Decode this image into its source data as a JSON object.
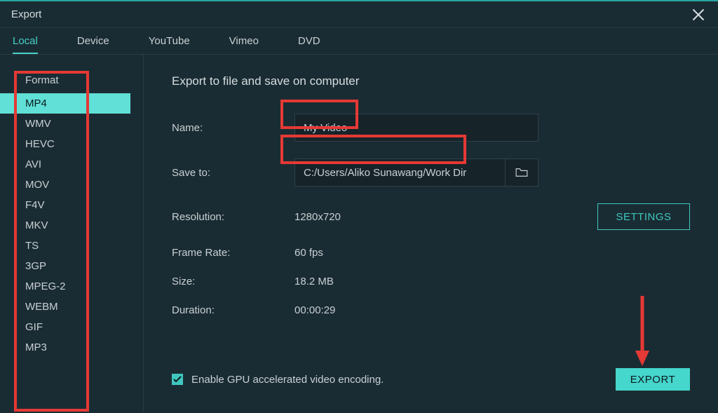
{
  "title": "Export",
  "tabs": [
    "Local",
    "Device",
    "YouTube",
    "Vimeo",
    "DVD"
  ],
  "active_tab": 0,
  "sidebar": {
    "heading": "Format",
    "items": [
      "MP4",
      "WMV",
      "HEVC",
      "AVI",
      "MOV",
      "F4V",
      "MKV",
      "TS",
      "3GP",
      "MPEG-2",
      "WEBM",
      "GIF",
      "MP3"
    ],
    "selected": 0
  },
  "main": {
    "heading": "Export to file and save on computer",
    "name_label": "Name:",
    "name_value": "My Video",
    "save_label": "Save to:",
    "save_value": "C:/Users/Aliko Sunawang/Work Dir",
    "resolution_label": "Resolution:",
    "resolution_value": "1280x720",
    "settings_label": "SETTINGS",
    "framerate_label": "Frame Rate:",
    "framerate_value": "60 fps",
    "size_label": "Size:",
    "size_value": "18.2 MB",
    "duration_label": "Duration:",
    "duration_value": "00:00:29",
    "gpu_label": "Enable GPU accelerated video encoding.",
    "export_label": "EXPORT"
  }
}
